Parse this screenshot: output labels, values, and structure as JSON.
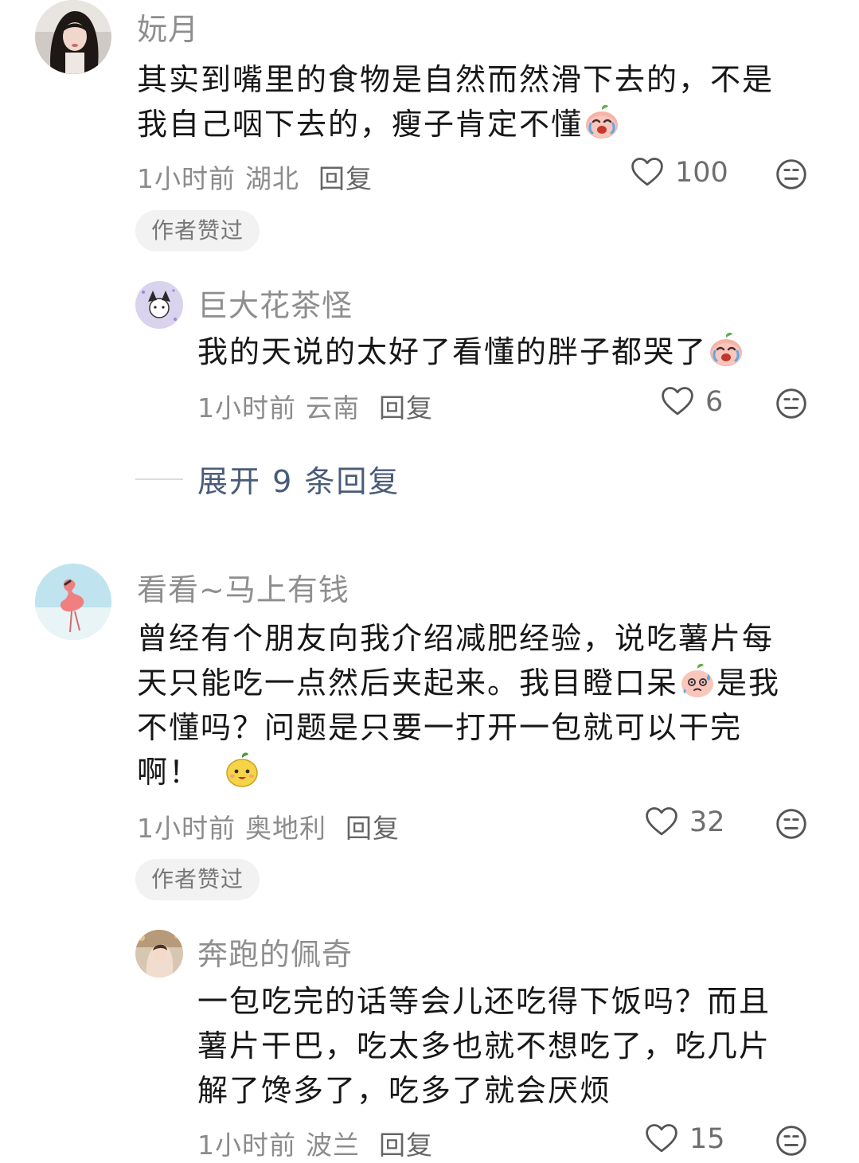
{
  "comments": [
    {
      "username": "妧月",
      "text_line1": "其实到嘴里的食物是自然而然滑下去的，不是",
      "text_line2": "我自己咽下去的，瘦子肯定不懂",
      "emoji": "crying-peach-emoji",
      "time": "1小时前",
      "location": "湖北",
      "reply_label": "回复",
      "likes": "100",
      "badge": "作者赞过",
      "replies": [
        {
          "username": "巨大花茶怪",
          "text": "我的天说的太好了看懂的胖子都哭了",
          "emoji": "crying-peach-emoji",
          "time": "1小时前",
          "location": "云南",
          "reply_label": "回复",
          "likes": "6"
        }
      ],
      "expand_label": "展开 9 条回复"
    },
    {
      "username": "看看~马上有钱",
      "text_line1": "曾经有个朋友向我介绍减肥经验，说吃薯片每",
      "text_line2a": "天只能吃一点然后夹起来。我目瞪口呆",
      "emoji_mid": "sweating-peach-emoji",
      "text_line2b": "是我",
      "text_line3": "不懂吗？问题是只要一打开一包就可以干完",
      "text_line4": "啊！",
      "emoji_end": "happy-mango-emoji",
      "time": "1小时前",
      "location": "奥地利",
      "reply_label": "回复",
      "likes": "32",
      "badge": "作者赞过",
      "replies": [
        {
          "username": "奔跑的佩奇",
          "text_line1": "一包吃完的话等会儿还吃得下饭吗？而且",
          "text_line2": "薯片干巴，吃太多也就不想吃了，吃几片",
          "text_line3": "解了馋多了，吃多了就会厌烦",
          "time": "1小时前",
          "location": "波兰",
          "reply_label": "回复",
          "likes": "15"
        }
      ]
    }
  ],
  "icons": {
    "like": "heart-outline-icon",
    "dislike": "neutral-face-icon"
  },
  "colors": {
    "username": "#8e8e8e",
    "text": "#171717",
    "meta": "#8c8c8c",
    "expand": "#4a5b7a",
    "badge_bg": "#f2f2f2"
  }
}
